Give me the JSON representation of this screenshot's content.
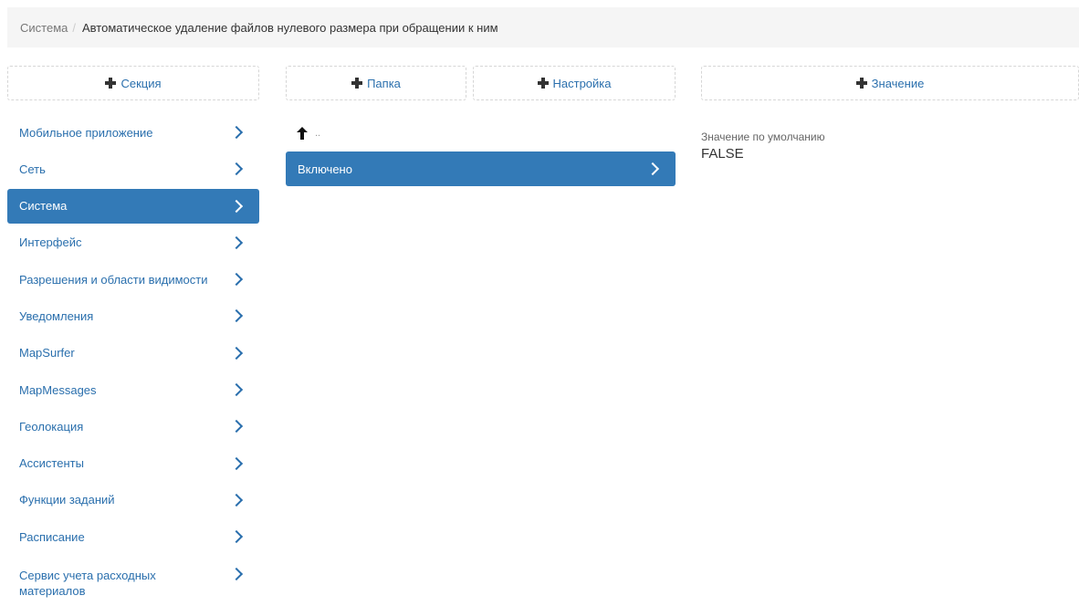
{
  "breadcrumb": {
    "root": "Система",
    "separator": "/",
    "current": "Автоматическое удаление файлов нулевого размера при обращении к ним"
  },
  "toolbar": {
    "add_section": "Секция",
    "add_folder": "Папка",
    "add_setting": "Настройка",
    "add_value": "Значение"
  },
  "sidebar": {
    "items": [
      {
        "label": "Мобильное приложение"
      },
      {
        "label": "Сеть"
      },
      {
        "label": "Система",
        "active": true
      },
      {
        "label": "Интерфейс"
      },
      {
        "label": "Разрешения и области видимости"
      },
      {
        "label": "Уведомления"
      },
      {
        "label": "MapSurfer"
      },
      {
        "label": "MapMessages"
      },
      {
        "label": "Геолокация"
      },
      {
        "label": "Ассистенты"
      },
      {
        "label": "Функции заданий"
      },
      {
        "label": "Расписание"
      },
      {
        "label": "Сервис учета расходных материалов"
      }
    ]
  },
  "folder": {
    "up_label": "..",
    "items": [
      {
        "label": "Включено",
        "active": true
      }
    ]
  },
  "value_panel": {
    "default_label": "Значение по умолчанию",
    "default_value": "FALSE"
  },
  "colors": {
    "accent": "#337ab7",
    "link": "#2a6fad",
    "breadcrumb_bg": "#f5f5f5"
  }
}
